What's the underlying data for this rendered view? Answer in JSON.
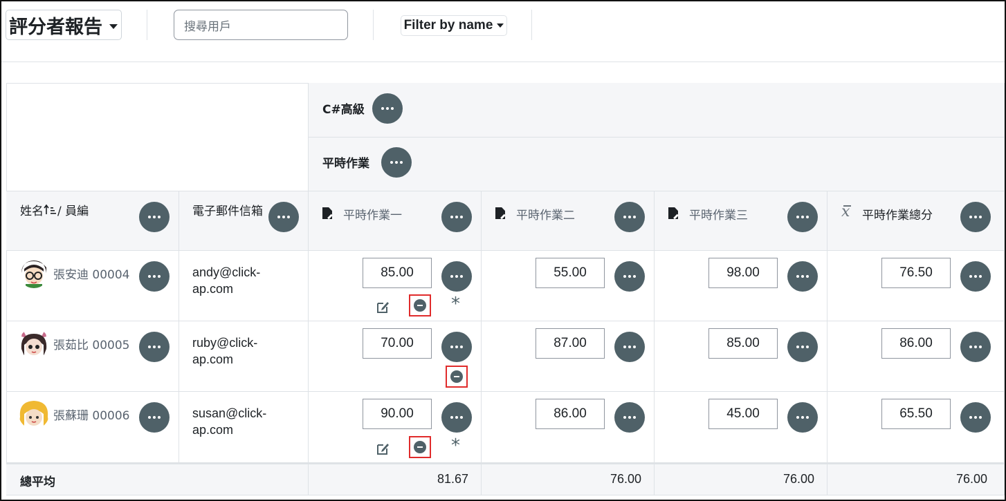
{
  "header": {
    "report_title": "評分者報告",
    "search_placeholder": "搜尋用戶",
    "filter_label": "Filter by name"
  },
  "categories": {
    "course": "C#高級",
    "category": "平時作業"
  },
  "columns": {
    "name": "姓名",
    "id": "/ 員編",
    "email": "電子郵件信箱",
    "items": [
      "平時作業一",
      "平時作業二",
      "平時作業三",
      "平時作業總分"
    ]
  },
  "students": [
    {
      "name": "張安迪 00004",
      "email_line1": "andy@click-",
      "email_line2": "ap.com",
      "grades": [
        "85.00",
        "55.00",
        "98.00",
        "76.50"
      ]
    },
    {
      "name": "張茹比 00005",
      "email_line1": "ruby@click-",
      "email_line2": "ap.com",
      "grades": [
        "70.00",
        "87.00",
        "85.00",
        "86.00"
      ]
    },
    {
      "name": "張蘇珊 00006",
      "email_line1": "susan@click-",
      "email_line2": "ap.com",
      "grades": [
        "90.00",
        "86.00",
        "45.00",
        "65.50"
      ]
    }
  ],
  "averages": {
    "label": "總平均",
    "values": [
      "81.67",
      "76.00",
      "76.00",
      "76.00"
    ]
  },
  "icons": {
    "action": "ellipsis-icon",
    "grade_item": "assignment-icon",
    "total": "mean-icon",
    "edit": "edit-icon",
    "excluded": "minus-circle-icon",
    "overridden": "asterisk-icon",
    "sort": "sort-asc-icon"
  },
  "colors": {
    "action_button": "#4f6168",
    "highlight": "#e02b2b",
    "header_bg": "#f5f6f8"
  }
}
